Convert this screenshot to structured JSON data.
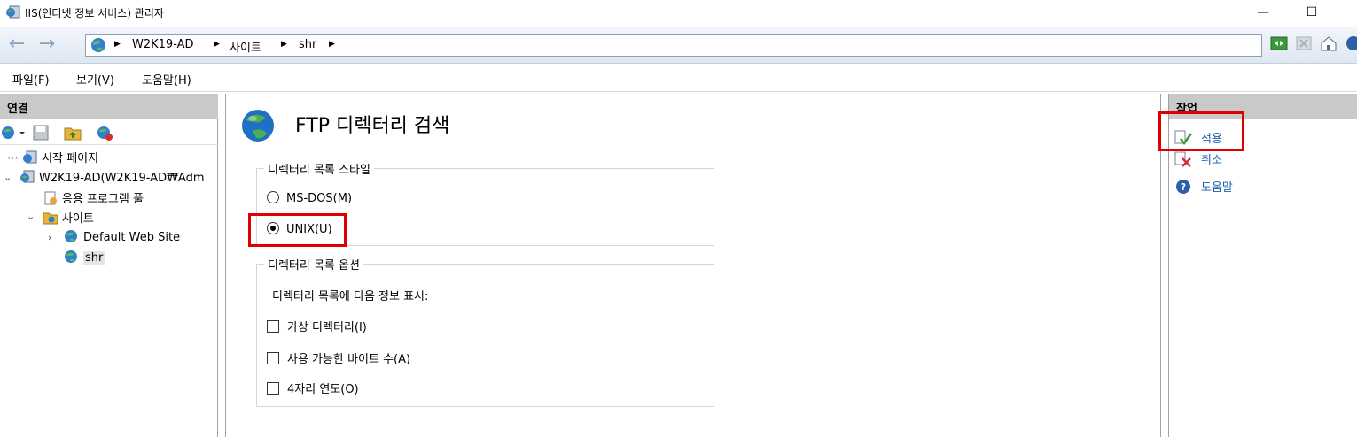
{
  "window": {
    "title": "IIS(인터넷 정보 서비스) 관리자",
    "minimize_label": "—",
    "maximize_label": "☐"
  },
  "address": {
    "breadcrumbs": [
      "W2K19-AD",
      "사이트",
      "shr"
    ]
  },
  "menu": {
    "items": [
      "파일(F)",
      "보기(V)",
      "도움말(H)"
    ]
  },
  "connections": {
    "header": "연결",
    "tree": {
      "start_page": "시작 페이지",
      "server": "W2K19-AD(W2K19-AD₩Adm",
      "app_pools": "응용 프로그램 풀",
      "sites": "사이트",
      "default_site": "Default Web Site",
      "shr": "shr"
    }
  },
  "main": {
    "title": "FTP 디렉터리 검색",
    "style_group": {
      "legend": "디렉터리 목록 스타일",
      "options": [
        {
          "label": "MS-DOS(M)",
          "selected": false
        },
        {
          "label": "UNIX(U)",
          "selected": true
        }
      ]
    },
    "options_group": {
      "legend": "디렉터리 목록 옵션",
      "description": "디렉터리 목록에 다음 정보 표시:",
      "checks": [
        {
          "label": "가상 디렉터리(I)",
          "checked": false
        },
        {
          "label": "사용 가능한 바이트 수(A)",
          "checked": false
        },
        {
          "label": "4자리 연도(O)",
          "checked": false
        }
      ]
    }
  },
  "actions": {
    "header": "작업",
    "apply": "적용",
    "cancel": "취소",
    "help": "도움말"
  },
  "colors": {
    "highlight": "#e00000",
    "link": "#1a5fb4",
    "pane_header": "#c9c9c9"
  }
}
